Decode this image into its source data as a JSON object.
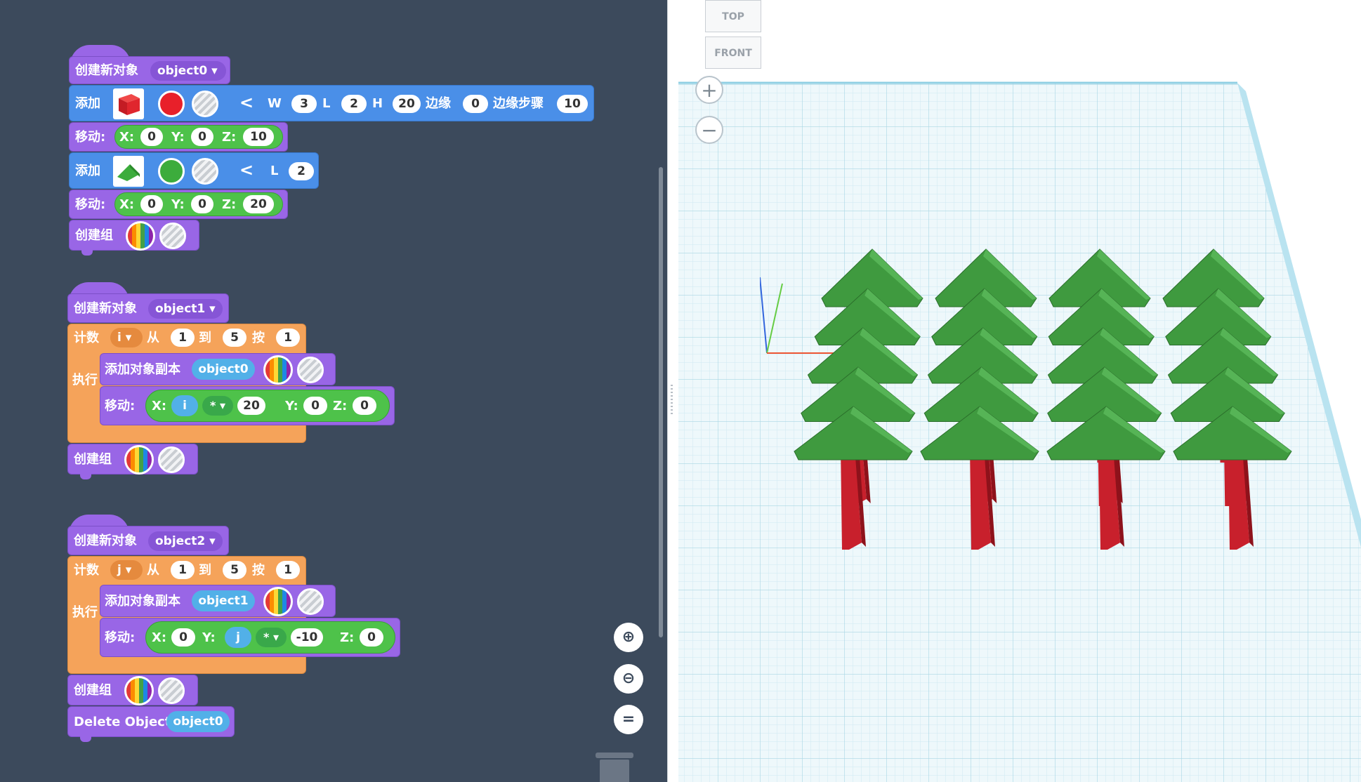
{
  "blocks": {
    "create_object_label": "创建新对象",
    "add_label": "添加",
    "move_label": "移动:",
    "create_group_label": "创建组",
    "count_label": "计数",
    "from_label": "从",
    "to_label": "到",
    "step_label": "按",
    "exec_label": "执行",
    "add_copy_label": "添加对象副本",
    "delete_label": "Delete Object",
    "x_label": "X:",
    "y_label": "Y:",
    "z_label": "Z:",
    "chevron": "<"
  },
  "stack1": {
    "object_name": "object0 ▾",
    "box": {
      "w_label": "W",
      "w": "3",
      "l_label": "L",
      "l": "2",
      "h_label": "H",
      "h": "20",
      "edge_label": "边缘",
      "edge": "0",
      "edge_step_label": "边缘步骤",
      "edge_step": "10",
      "color": "#e8202a"
    },
    "move1": {
      "x": "0",
      "y": "0",
      "z": "10"
    },
    "roof": {
      "l_label": "L",
      "l": "2",
      "color": "#3cac3c"
    },
    "move2": {
      "x": "0",
      "y": "0",
      "z": "20"
    }
  },
  "stack2": {
    "object_name": "object1 ▾",
    "loop_var": "i ▾",
    "from": "1",
    "to": "5",
    "step": "1",
    "copy_object": "object0",
    "move": {
      "x_var": "i",
      "op": "* ▾",
      "x_factor": "20",
      "y": "0",
      "z": "0"
    }
  },
  "stack3": {
    "object_name": "object2 ▾",
    "loop_var": "j ▾",
    "from": "1",
    "to": "5",
    "step": "1",
    "copy_object": "object1",
    "move": {
      "x": "0",
      "y_var": "j",
      "op": "* ▾",
      "y_factor": "-10",
      "z": "0"
    },
    "delete_object": "object0"
  },
  "workspace_tools": {
    "zoom_in_icon": "⊕",
    "zoom_out_icon": "⊖",
    "reset_icon": "="
  },
  "viewport": {
    "viewcube_top": "TOP",
    "viewcube_front": "FRONT",
    "zoom_in": "+",
    "zoom_out": "−",
    "grid_color": "#cdeaf3",
    "tree_rows": 5,
    "tree_cols": 4,
    "roof_color": "#3f9a3f",
    "trunk_color": "#c8202c"
  }
}
